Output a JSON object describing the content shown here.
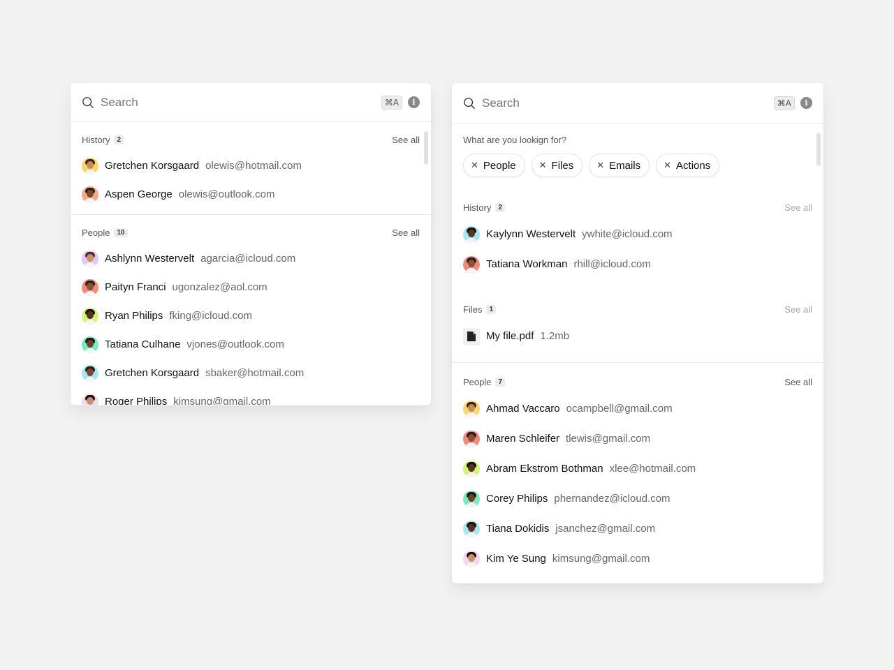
{
  "left_panel": {
    "search": {
      "placeholder": "Search",
      "shortcut": "⌘A"
    },
    "history": {
      "title": "History",
      "count": "2",
      "see_all": "See all",
      "items": [
        {
          "name": "Gretchen Korsgaard",
          "email": "olewis@hotmail.com",
          "avatar_color": "#f7d774",
          "face": "#c98a5a",
          "hair": "#3a2416"
        },
        {
          "name": "Aspen George",
          "email": "olewis@outlook.com",
          "avatar_color": "#f4a98a",
          "face": "#7a4a30",
          "hair": "#2a1a12"
        }
      ]
    },
    "people": {
      "title": "People",
      "count": "10",
      "see_all": "See all",
      "items": [
        {
          "name": "Ashlynn Westervelt",
          "email": "agarcia@icloud.com",
          "avatar_color": "#e2c6f4",
          "face": "#c9946a",
          "hair": "#4a3020"
        },
        {
          "name": "Paityn Franci",
          "email": "ugonzalez@aol.com",
          "avatar_color": "#ef8a7e",
          "face": "#8a5234",
          "hair": "#2a1a12"
        },
        {
          "name": "Ryan Philips",
          "email": "fking@icloud.com",
          "avatar_color": "#d4f47a",
          "face": "#5a3320",
          "hair": "#1a100a"
        },
        {
          "name": "Tatiana Culhane",
          "email": "vjones@outlook.com",
          "avatar_color": "#7ee8c0",
          "face": "#6a4028",
          "hair": "#1f140c"
        },
        {
          "name": "Gretchen Korsgaard",
          "email": "sbaker@hotmail.com",
          "avatar_color": "#a9e6f4",
          "face": "#7a4a30",
          "hair": "#2a1a12"
        },
        {
          "name": "Roger Philips",
          "email": "kimsung@gmail.com",
          "avatar_color": "#f2d9ec",
          "face": "#c99070",
          "hair": "#1a100a"
        }
      ]
    }
  },
  "right_panel": {
    "search": {
      "placeholder": "Search",
      "shortcut": "⌘A"
    },
    "filters": {
      "question": "What are you lookign for?",
      "chips": [
        "People",
        "Files",
        "Emails",
        "Actions"
      ]
    },
    "history": {
      "title": "History",
      "count": "2",
      "see_all": "See all",
      "items": [
        {
          "name": "Kaylynn Westervelt",
          "email": "ywhite@icloud.com",
          "avatar_color": "#a9e6f4",
          "face": "#5a3320",
          "hair": "#1a100a"
        },
        {
          "name": "Tatiana Workman",
          "email": "rhill@icloud.com",
          "avatar_color": "#ef8a7e",
          "face": "#8a5234",
          "hair": "#2a1a12"
        }
      ]
    },
    "files": {
      "title": "Files",
      "count": "1",
      "see_all": "See all",
      "items": [
        {
          "name": "My file.pdf",
          "size": "1.2mb"
        }
      ]
    },
    "people": {
      "title": "People",
      "count": "7",
      "see_all": "See all",
      "items": [
        {
          "name": "Ahmad Vaccaro",
          "email": "ocampbell@gmail.com",
          "avatar_color": "#f7d774",
          "face": "#c98a5a",
          "hair": "#3a2416"
        },
        {
          "name": "Maren Schleifer",
          "email": "tlewis@gmail.com",
          "avatar_color": "#ef8a7e",
          "face": "#8a5234",
          "hair": "#2a1a12"
        },
        {
          "name": "Abram Ekstrom Bothman",
          "email": "xlee@hotmail.com",
          "avatar_color": "#d4f47a",
          "face": "#5a3320",
          "hair": "#1a100a"
        },
        {
          "name": "Corey Philips",
          "email": "phernandez@icloud.com",
          "avatar_color": "#7ee8c0",
          "face": "#6a4028",
          "hair": "#1f140c"
        },
        {
          "name": "Tiana Dokidis",
          "email": "jsanchez@gmail.com",
          "avatar_color": "#a9e6f4",
          "face": "#5a3320",
          "hair": "#1a100a"
        },
        {
          "name": "Kim Ye Sung",
          "email": "kimsung@gmail.com",
          "avatar_color": "#f2d9ec",
          "face": "#c99070",
          "hair": "#1a100a"
        }
      ]
    }
  }
}
